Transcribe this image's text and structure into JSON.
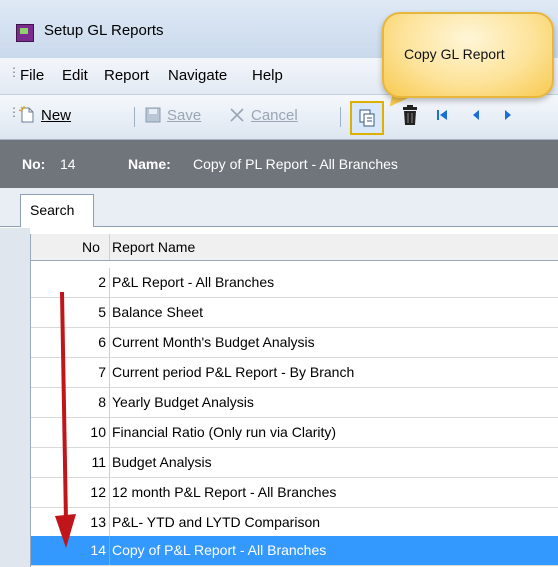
{
  "window": {
    "title": "Setup GL Reports"
  },
  "menu": [
    "File",
    "Edit",
    "Report",
    "Navigate",
    "Help"
  ],
  "toolbar": {
    "new_label": "New",
    "save_label": "Save",
    "cancel_label": "Cancel"
  },
  "record": {
    "no_label": "No:",
    "no_value": "14",
    "name_label": "Name:",
    "name_value": "Copy of PL Report - All Branches"
  },
  "tabs": [
    "Search"
  ],
  "grid": {
    "headers": [
      "No",
      "Report Name"
    ],
    "rows": [
      {
        "no": "2",
        "name": "P&L Report - All Branches"
      },
      {
        "no": "5",
        "name": "Balance Sheet"
      },
      {
        "no": "6",
        "name": "Current Month's Budget Analysis"
      },
      {
        "no": "7",
        "name": "Current period P&L Report - By Branch"
      },
      {
        "no": "8",
        "name": "Yearly Budget Analysis"
      },
      {
        "no": "10",
        "name": "Financial Ratio (Only run via Clarity)"
      },
      {
        "no": "11",
        "name": "Budget Analysis"
      },
      {
        "no": "12",
        "name": "12 month P&L Report - All Branches"
      },
      {
        "no": "13",
        "name": "P&L- YTD and LYTD Comparison"
      },
      {
        "no": "14",
        "name": "Copy of P&L Report - All Branches"
      }
    ]
  },
  "callout": {
    "text": "Copy GL Report"
  },
  "colors": {
    "selection": "#3399ff",
    "highlight": "#fff24d",
    "arrow": "#c0161b",
    "info_bar": "#6f757b"
  }
}
